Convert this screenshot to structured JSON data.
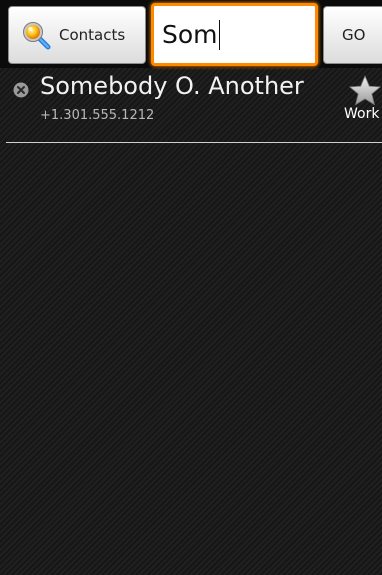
{
  "search_bar": {
    "source_label": "Contacts",
    "source_icon": "magnifier-search-icon",
    "query": "Som",
    "go_label": "GO",
    "accent_color": "#ff8a00"
  },
  "suggestions": [
    {
      "name": "Somebody O. Another",
      "phone": "+1.301.555.1212",
      "type_label": "Work",
      "leading_icon": "clear-icon",
      "trailing_icon": "star-icon"
    }
  ]
}
